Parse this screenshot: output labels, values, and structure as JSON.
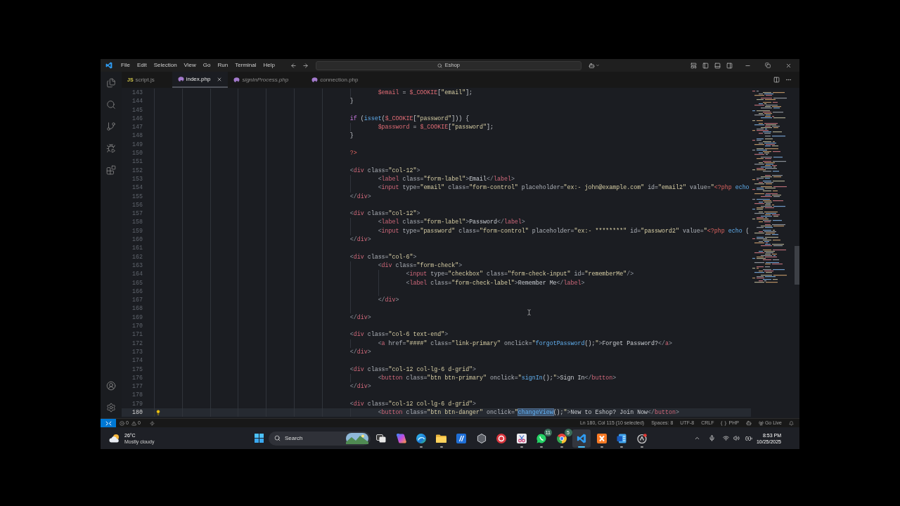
{
  "title_bar": {
    "menu": [
      "File",
      "Edit",
      "Selection",
      "View",
      "Go",
      "Run",
      "Terminal",
      "Help"
    ],
    "command_center": {
      "label": "Eshop"
    }
  },
  "tabs": [
    {
      "label": "script.js",
      "kind": "js",
      "icon_label": "JS",
      "selected": false,
      "preview": false
    },
    {
      "label": "index.php",
      "kind": "php",
      "selected": true,
      "preview": false
    },
    {
      "label": "signInProcess.php",
      "kind": "php",
      "selected": false,
      "preview": true
    },
    {
      "label": "connection.php",
      "kind": "php",
      "selected": false,
      "preview": false
    }
  ],
  "editor": {
    "lines": [
      {
        "number": "143",
        "current": false,
        "text": "\t\t\t\t\t\t\t\t$email = $_COOKIE[\"email\"];"
      },
      {
        "number": "144",
        "current": false,
        "text": "\t\t\t\t\t\t\t}"
      },
      {
        "number": "145",
        "current": false
      },
      {
        "number": "146",
        "current": false,
        "text": "\t\t\t\t\t\t\tif (isset($_COOKIE[\"password\"])) {"
      },
      {
        "number": "147",
        "current": false,
        "text": "\t\t\t\t\t\t\t\t$password = $_COOKIE[\"password\"];"
      },
      {
        "number": "148",
        "current": false,
        "text": "\t\t\t\t\t\t\t}"
      },
      {
        "number": "149",
        "current": false
      },
      {
        "number": "150",
        "current": false,
        "text": "\t\t\t\t\t\t\t?>"
      },
      {
        "number": "151",
        "current": false
      },
      {
        "number": "152",
        "current": false,
        "text": "\t\t\t\t\t\t\t<div class=\"col-12\">"
      },
      {
        "number": "153",
        "current": false,
        "text": "\t\t\t\t\t\t\t\t<label class=\"form-label\">Email</label>"
      },
      {
        "number": "154",
        "current": false,
        "text": "\t\t\t\t\t\t\t\t<input type=\"email\" class=\"form-control\" placeholder=\"ex:- john@example.com\" id=\"email2\" value=\"<?php echo"
      },
      {
        "number": "155",
        "current": false,
        "text": "\t\t\t\t\t\t\t</div>"
      },
      {
        "number": "156",
        "current": false
      },
      {
        "number": "157",
        "current": false,
        "text": "\t\t\t\t\t\t\t<div class=\"col-12\">"
      },
      {
        "number": "158",
        "current": false,
        "text": "\t\t\t\t\t\t\t\t<label class=\"form-label\">Password</label>"
      },
      {
        "number": "159",
        "current": false,
        "text": "\t\t\t\t\t\t\t\t<input type=\"password\" class=\"form-control\" placeholder=\"ex:- ********\" id=\"password2\" value=\"<?php echo ("
      },
      {
        "number": "160",
        "current": false,
        "text": "\t\t\t\t\t\t\t</div>"
      },
      {
        "number": "161",
        "current": false
      },
      {
        "number": "162",
        "current": false,
        "text": "\t\t\t\t\t\t\t<div class=\"col-6\">"
      },
      {
        "number": "163",
        "current": false,
        "text": "\t\t\t\t\t\t\t\t<div class=\"form-check\">"
      },
      {
        "number": "164",
        "current": false,
        "text": "\t\t\t\t\t\t\t\t\t<input type=\"checkbox\" class=\"form-check-input\" id=\"rememberMe\"/>"
      },
      {
        "number": "165",
        "current": false,
        "text": "\t\t\t\t\t\t\t\t\t<label class=\"form-check-label\">Remember Me</label>"
      },
      {
        "number": "166",
        "current": false
      },
      {
        "number": "167",
        "current": false,
        "text": "\t\t\t\t\t\t\t\t</div>"
      },
      {
        "number": "168",
        "current": false
      },
      {
        "number": "169",
        "current": false,
        "text": "\t\t\t\t\t\t\t</div>"
      },
      {
        "number": "170",
        "current": false
      },
      {
        "number": "171",
        "current": false,
        "text": "\t\t\t\t\t\t\t<div class=\"col-6 text-end\">"
      },
      {
        "number": "172",
        "current": false,
        "text": "\t\t\t\t\t\t\t\t<a href=\"####\" class=\"link-primary\" onclick=\"forgotPassword();\">Forget Password?</a>"
      },
      {
        "number": "173",
        "current": false,
        "text": "\t\t\t\t\t\t\t</div>"
      },
      {
        "number": "174",
        "current": false
      },
      {
        "number": "175",
        "current": false,
        "text": "\t\t\t\t\t\t\t<div class=\"col-12 col-lg-6 d-grid\">"
      },
      {
        "number": "176",
        "current": false,
        "text": "\t\t\t\t\t\t\t\t<button class=\"btn btn-primary\" onclick=\"signIn();\">Sign In</button>"
      },
      {
        "number": "177",
        "current": false,
        "text": "\t\t\t\t\t\t\t</div>"
      },
      {
        "number": "178",
        "current": false
      },
      {
        "number": "179",
        "current": false,
        "text": "\t\t\t\t\t\t\t<div class=\"col-12 col-lg-6 d-grid\">"
      },
      {
        "number": "180",
        "current": true,
        "parts": [
          {
            "text": "\t\t\t\t\t\t\t\t<button class=\"btn btn-danger\" onclick=\"",
            "selected": false
          },
          {
            "text": "changeView",
            "selected": true
          },
          {
            "text": "();\">New to Eshop? Join Now</button>",
            "selected": false
          }
        ]
      }
    ]
  },
  "status_bar": {
    "errors": "0",
    "warnings": "0",
    "cursor_position": "Ln 180, Col 115 (10 selected)",
    "indentation": "Spaces: 8",
    "encoding": "UTF-8",
    "line_ending": "CRLF",
    "language": "PHP",
    "live_server": "Go Live"
  },
  "taskbar": {
    "weather": {
      "temperature": "26°C",
      "condition": "Mostly cloudy"
    },
    "search": {
      "placeholder": "Search"
    },
    "apps": [
      {
        "kind": "taskview",
        "running": false,
        "active": false
      },
      {
        "kind": "copilot",
        "running": false,
        "active": false
      },
      {
        "kind": "edge",
        "running": true,
        "active": false
      },
      {
        "kind": "explorer",
        "running": true,
        "active": false
      },
      {
        "kind": "tile",
        "running": false,
        "active": false
      },
      {
        "kind": "hexagon",
        "running": false,
        "active": false
      },
      {
        "kind": "ring",
        "running": false,
        "active": false
      },
      {
        "kind": "snip",
        "running": true,
        "active": false
      },
      {
        "kind": "chat",
        "running": true,
        "active": false,
        "badge": "11"
      },
      {
        "kind": "chrome",
        "running": true,
        "active": false,
        "badge": "5"
      },
      {
        "kind": "vscode",
        "running": true,
        "active": true
      },
      {
        "kind": "xampp",
        "running": true,
        "active": false
      },
      {
        "kind": "word",
        "running": true,
        "active": false
      },
      {
        "kind": "circle",
        "running": true,
        "active": false
      }
    ],
    "clock": {
      "time": "8:53 PM",
      "date": "10/25/2025"
    }
  }
}
